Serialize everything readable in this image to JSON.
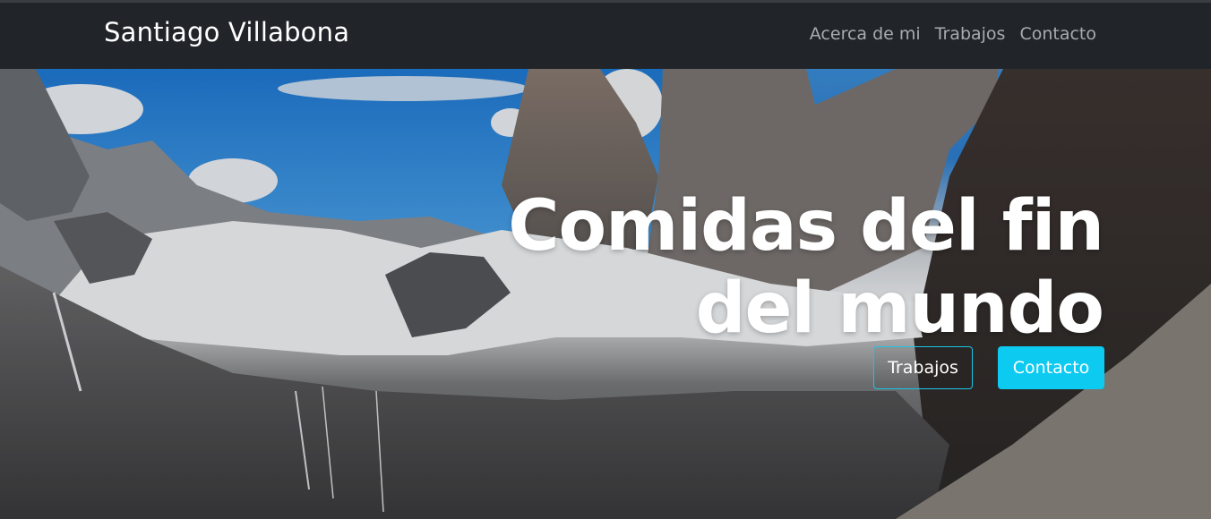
{
  "navbar": {
    "brand": "Santiago Villabona",
    "links": [
      "Acerca de mi",
      "Trabajos",
      "Contacto"
    ]
  },
  "hero": {
    "title": "Comidas del fin del mundo",
    "buttons": {
      "primary": "Trabajos",
      "secondary": "Contacto"
    }
  },
  "colors": {
    "navbar_bg": "#212529",
    "accent": "#0dcaf0",
    "nav_link": "#a8abaf"
  }
}
